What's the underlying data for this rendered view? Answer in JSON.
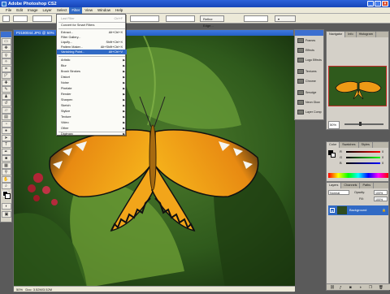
{
  "window": {
    "title": "Adobe Photoshop CS2"
  },
  "menubar": [
    "File",
    "Edit",
    "Image",
    "Layer",
    "Select",
    "Filter",
    "View",
    "Window",
    "Help"
  ],
  "optionsbar": {
    "refine_label": "Refine Edge..."
  },
  "document": {
    "title": "P2180044.JPG @ 50%",
    "zoom": "50%",
    "doc_size": "Doc: 3.52M/3.52M"
  },
  "filter_menu": {
    "last_filter": {
      "label": "Last Filter",
      "shortcut": "Ctrl+F"
    },
    "convert": "Convert for Smart Filters",
    "extract": {
      "label": "Extract...",
      "shortcut": "Alt+Ctrl+X"
    },
    "filter_gallery": "Filter Gallery...",
    "liquify": {
      "label": "Liquify...",
      "shortcut": "Shift+Ctrl+X"
    },
    "pattern_maker": {
      "label": "Pattern Maker...",
      "shortcut": "Alt+Shift+Ctrl+X"
    },
    "vanishing_point": {
      "label": "Vanishing Point...",
      "shortcut": "Alt+Ctrl+V"
    },
    "categories": [
      "Artistic",
      "Blur",
      "Brush Strokes",
      "Distort",
      "Noise",
      "Pixelate",
      "Render",
      "Sharpen",
      "Sketch",
      "Stylize",
      "Texture",
      "Video",
      "Other"
    ],
    "digimarc": "Digimarc"
  },
  "actions": [
    {
      "label": "Frames"
    },
    {
      "label": "Effects"
    },
    {
      "label": "Logo Effects"
    },
    {
      "label": "Textures"
    },
    {
      "label": "Chrome"
    },
    {
      "label": "Smudge"
    },
    {
      "label": "Neon Glow"
    },
    {
      "label": "Watercolor"
    },
    {
      "label": "Layer Comp"
    }
  ],
  "navigator": {
    "tabs": [
      "Navigator",
      "Info",
      "Histogram"
    ],
    "zoom": "50%"
  },
  "color": {
    "tabs": [
      "Color",
      "Swatches",
      "Styles"
    ],
    "labels": [
      "R",
      "G",
      "B"
    ],
    "values": [
      "0",
      "0",
      "0"
    ]
  },
  "layers": {
    "tabs": [
      "Layers",
      "Channels",
      "Paths"
    ],
    "blend": "Normal",
    "opacity_label": "Opacity:",
    "opacity": "100%",
    "fill_label": "Fill:",
    "fill": "100%",
    "layer_name": "Background"
  }
}
